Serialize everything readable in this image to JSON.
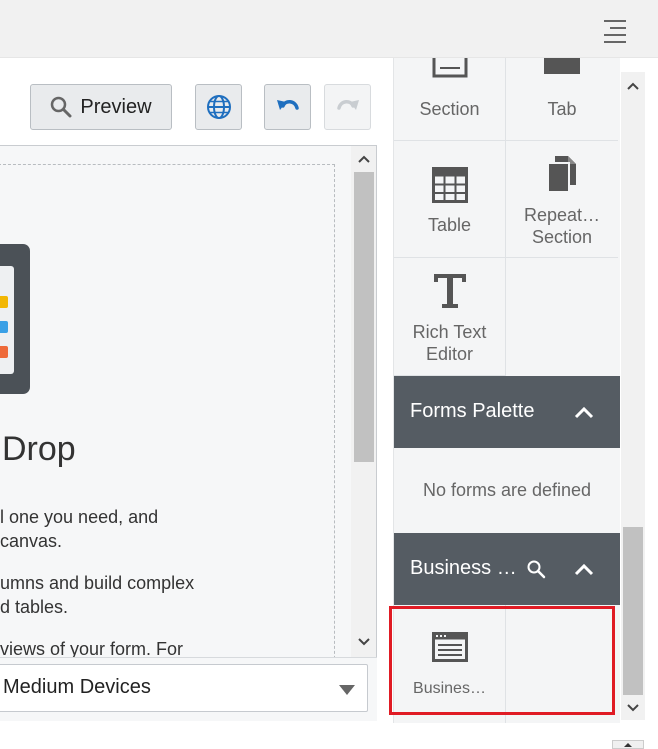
{
  "toolbar": {
    "preview_label": "Preview",
    "preview_icon": "magnifier-icon",
    "globe_icon": "globe-icon",
    "undo_icon": "undo-icon",
    "redo_icon": "redo-icon"
  },
  "canvas": {
    "heading": "Drop",
    "lines": [
      "l one you need, and",
      "canvas.",
      "umns and build complex",
      "d tables.",
      "views of your form. For"
    ],
    "device_select_value": "Medium Devices"
  },
  "palette": {
    "tiles": [
      {
        "label": "Section",
        "icon": "section-icon"
      },
      {
        "label": "Tab",
        "icon": "tab-icon"
      },
      {
        "label": "Table",
        "icon": "table-icon"
      },
      {
        "label": "Repeat... Section",
        "line1": "Repeat…",
        "line2": "Section",
        "icon": "repeating-section-icon"
      },
      {
        "label": "Rich Text Editor",
        "line1": "Rich Text",
        "line2": "Editor",
        "icon": "rich-text-icon"
      }
    ],
    "forms_palette_title": "Forms Palette",
    "no_forms_text": "No forms are defined",
    "business_title": "Business …",
    "business_tile_label": "Busines…"
  },
  "colors": {
    "accordion_header": "#555c63",
    "highlight": "#e01b24",
    "undo_blue": "#1f6fbf"
  }
}
